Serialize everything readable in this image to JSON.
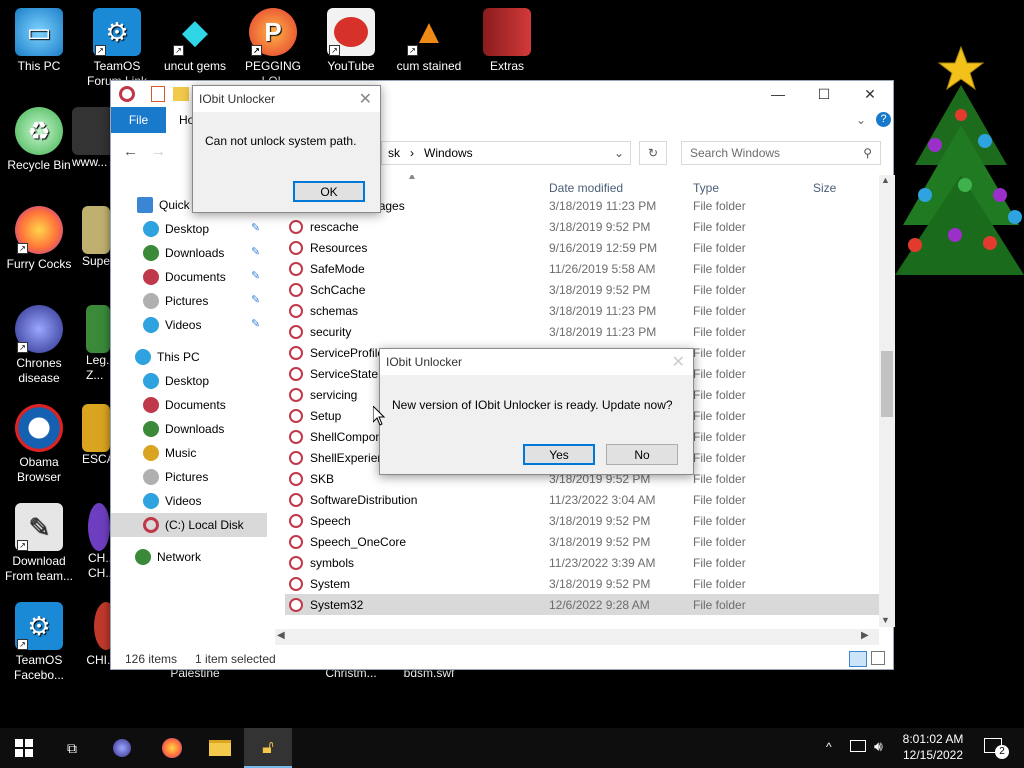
{
  "desktop": {
    "icons": [
      {
        "label": "This PC",
        "icon": "this-pc-icon",
        "color": "#2ea3e0"
      },
      {
        "label": "TeamOS Forum Link",
        "icon": "gear-icon",
        "color": "#1a8ad6"
      },
      {
        "label": "uncut gems",
        "icon": "diamond-icon",
        "color": "#22c6d8"
      },
      {
        "label": "PEGGING LOL",
        "icon": "p-logo-icon",
        "color": "#e23b2e"
      },
      {
        "label": "YouTube",
        "icon": "angry-bird-icon",
        "color": "#d8312a"
      },
      {
        "label": "cum stained",
        "icon": "vlc-icon",
        "color": "#f08a16"
      },
      {
        "label": "Extras",
        "icon": "red-folder-icon",
        "color": "#c22b2b"
      },
      {
        "label": "Recycle Bin",
        "icon": "recycle-bin-icon",
        "color": "#3fb24e"
      },
      {
        "label": "www...",
        "icon": "document-icon",
        "color": "#444444"
      },
      {
        "label": "Furry Cocks",
        "icon": "firefox-icon",
        "color": "#ff7139"
      },
      {
        "label": "Super...",
        "icon": "game-icon",
        "color": "#c0b070"
      },
      {
        "label": "Chrones disease",
        "icon": "orb-icon",
        "color": "#3340a8"
      },
      {
        "label": "Leg... Z...",
        "icon": "game-icon",
        "color": "#3a8a3a"
      },
      {
        "label": "Obama Browser",
        "icon": "obama-logo-icon",
        "color": "#1560b0"
      },
      {
        "label": "ESCA...",
        "icon": "folder-icon",
        "color": "#d9a520"
      },
      {
        "label": "Download From team...",
        "icon": "download-icon",
        "color": "#888888"
      },
      {
        "label": "CH... CH...",
        "icon": "orb-icon",
        "color": "#6d3fc0"
      },
      {
        "label": "TeamOS Facebo...",
        "icon": "gear-icon",
        "color": "#1a8ad6"
      },
      {
        "label": "CHI... CUM",
        "icon": "orb-icon",
        "color": "#c0392b"
      },
      {
        "label": "Palestine",
        "icon": "file-icon",
        "color": "#333333"
      },
      {
        "label": "Christm...",
        "icon": "file-icon",
        "color": "#333333"
      },
      {
        "label": "bdsm.swf",
        "icon": "file-icon",
        "color": "#333333"
      }
    ]
  },
  "explorer": {
    "title_dialog": "IObit Unlocker",
    "tab_file": "File",
    "tab_home": "Ho",
    "breadcrumb_prefix": "sk",
    "breadcrumb_current": "Windows",
    "search_placeholder": "Search Windows",
    "columns": {
      "name": "Name",
      "date": "Date modified",
      "type": "Type",
      "size": "Size"
    },
    "nav": {
      "quick_access": "Quick a",
      "quick_items": [
        "Desktop",
        "Downloads",
        "Documents",
        "Pictures",
        "Videos"
      ],
      "this_pc": "This PC",
      "pc_items": [
        "Desktop",
        "Documents",
        "Downloads",
        "Music",
        "Pictures",
        "Videos",
        "(C:) Local Disk"
      ],
      "network": "Network"
    },
    "rows": [
      {
        "name": "RemotePackages",
        "date": "3/18/2019 11:23 PM",
        "type": "File folder"
      },
      {
        "name": "rescache",
        "date": "3/18/2019 9:52 PM",
        "type": "File folder"
      },
      {
        "name": "Resources",
        "date": "9/16/2019 12:59 PM",
        "type": "File folder"
      },
      {
        "name": "SafeMode",
        "date": "11/26/2019 5:58 AM",
        "type": "File folder"
      },
      {
        "name": "SchCache",
        "date": "3/18/2019 9:52 PM",
        "type": "File folder"
      },
      {
        "name": "schemas",
        "date": "3/18/2019 11:23 PM",
        "type": "File folder"
      },
      {
        "name": "security",
        "date": "3/18/2019 11:23 PM",
        "type": "File folder"
      },
      {
        "name": "ServiceProfile",
        "date": "",
        "type": "File folder"
      },
      {
        "name": "ServiceState",
        "date": "",
        "type": "File folder"
      },
      {
        "name": "servicing",
        "date": "",
        "type": "File folder"
      },
      {
        "name": "Setup",
        "date": "",
        "type": "File folder"
      },
      {
        "name": "ShellCompon",
        "date": "",
        "type": "File folder"
      },
      {
        "name": "ShellExperien",
        "date": "",
        "type": "File folder"
      },
      {
        "name": "SKB",
        "date": "3/18/2019 9:52 PM",
        "type": "File folder"
      },
      {
        "name": "SoftwareDistribution",
        "date": "11/23/2022 3:04 AM",
        "type": "File folder"
      },
      {
        "name": "Speech",
        "date": "3/18/2019 9:52 PM",
        "type": "File folder"
      },
      {
        "name": "Speech_OneCore",
        "date": "3/18/2019 9:52 PM",
        "type": "File folder"
      },
      {
        "name": "symbols",
        "date": "11/23/2022 3:39 AM",
        "type": "File folder"
      },
      {
        "name": "System",
        "date": "3/18/2019 9:52 PM",
        "type": "File folder"
      },
      {
        "name": "System32",
        "date": "12/6/2022 9:28 AM",
        "type": "File folder"
      }
    ],
    "status_count": "126 items",
    "status_selected": "1 item selected"
  },
  "dialog1": {
    "title": "IObit Unlocker",
    "message": "Can not unlock system path.",
    "ok": "OK"
  },
  "dialog2": {
    "title": "IObit Unlocker",
    "message": "New version of IObit Unlocker is ready. Update now?",
    "yes": "Yes",
    "no": "No"
  },
  "taskbar": {
    "time": "8:01:02 AM",
    "date": "12/15/2022",
    "notifications": "2"
  },
  "colors": {
    "accent": "#0078d7",
    "file_tab": "#1979ca",
    "selected_row": "#d9d9d9"
  }
}
